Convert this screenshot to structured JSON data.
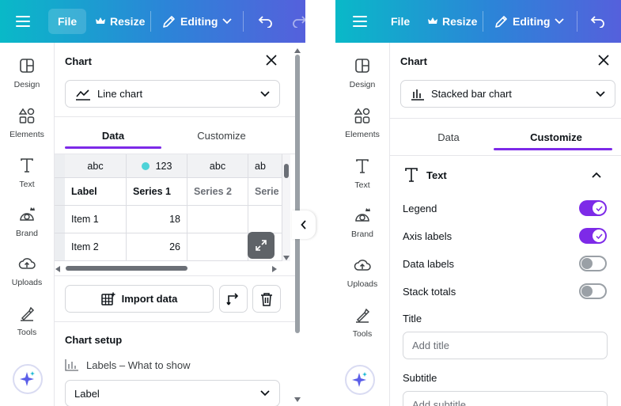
{
  "toolbar": {
    "file": "File",
    "resize": "Resize",
    "editing": "Editing"
  },
  "rail": {
    "design": "Design",
    "elements": "Elements",
    "text": "Text",
    "brand": "Brand",
    "uploads": "Uploads",
    "tools": "Tools"
  },
  "left_panel": {
    "title": "Chart",
    "chart_type": "Line chart",
    "tabs": [
      "Data",
      "Customize"
    ],
    "active_tab": "Data",
    "table": {
      "type_row": [
        "abc",
        "123",
        "abc",
        "ab"
      ],
      "header_row": [
        "Label",
        "Series 1",
        "Series 2",
        "Serie"
      ],
      "rows": [
        [
          "Item 1",
          "18",
          "",
          ""
        ],
        [
          "Item 2",
          "26",
          "",
          ""
        ]
      ]
    },
    "import_label": "Import data",
    "chart_setup_title": "Chart setup",
    "labels_what_to_show": "Labels – What to show",
    "label_select_value": "Label"
  },
  "right_panel": {
    "title": "Chart",
    "chart_type": "Stacked bar chart",
    "tabs": [
      "Data",
      "Customize"
    ],
    "active_tab": "Customize",
    "section_title": "Text",
    "toggles": [
      {
        "label": "Legend",
        "on": true
      },
      {
        "label": "Axis labels",
        "on": true
      },
      {
        "label": "Data labels",
        "on": false
      },
      {
        "label": "Stack totals",
        "on": false
      }
    ],
    "title_label": "Title",
    "title_placeholder": "Add title",
    "subtitle_label": "Subtitle",
    "subtitle_placeholder": "Add subtitle"
  },
  "colors": {
    "accent": "#7d2ae8",
    "series_dot": "#4ed3d8"
  }
}
